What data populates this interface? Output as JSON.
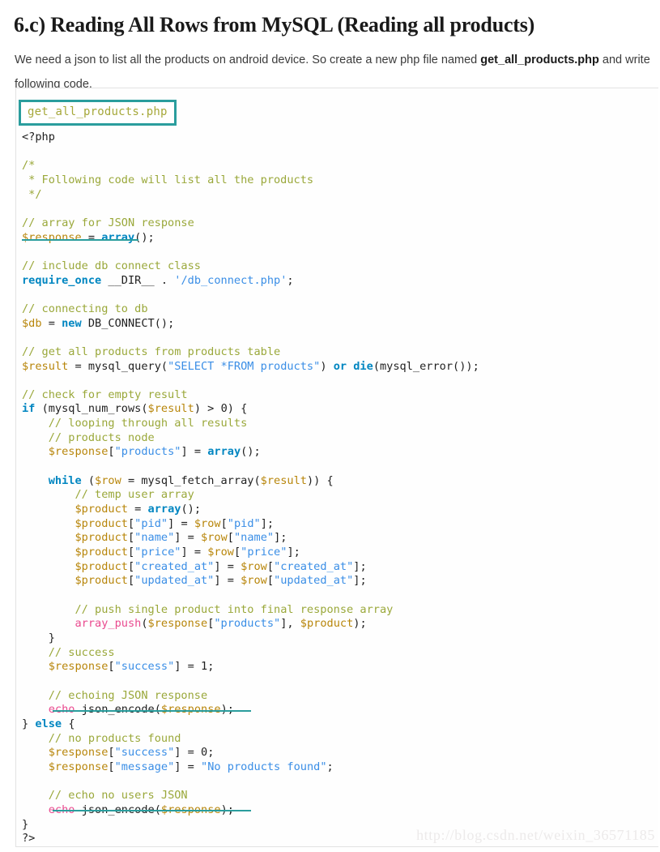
{
  "heading": "6.c) Reading All Rows from MySQL (Reading all products)",
  "intro": {
    "before": "We need a json to list all the products on android device. So create a new php file named ",
    "file_name": "get_all_products.php",
    "after": " and write following code."
  },
  "code_block": {
    "filename_chip": "get_all_products.php",
    "language": "php",
    "source": "<?php\n\n/*\n * Following code will list all the products\n */\n\n// array for JSON response\n$response = array();\n\n// include db connect class\nrequire_once __DIR__ . '/db_connect.php';\n\n// connecting to db\n$db = new DB_CONNECT();\n\n// get all products from products table\n$result = mysql_query(\"SELECT *FROM products\") or die(mysql_error());\n\n// check for empty result\nif (mysql_num_rows($result) > 0) {\n    // looping through all results\n    // products node\n    $response[\"products\"] = array();\n\n    while ($row = mysql_fetch_array($result)) {\n        // temp user array\n        $product = array();\n        $product[\"pid\"] = $row[\"pid\"];\n        $product[\"name\"] = $row[\"name\"];\n        $product[\"price\"] = $row[\"price\"];\n        $product[\"created_at\"] = $row[\"created_at\"];\n        $product[\"updated_at\"] = $row[\"updated_at\"];\n\n        // push single product into final response array\n        array_push($response[\"products\"], $product);\n    }\n    // success\n    $response[\"success\"] = 1;\n\n    // echoing JSON response\n    echo json_encode($response);\n} else {\n    // no products found\n    $response[\"success\"] = 0;\n    $response[\"message\"] = \"No products found\";\n\n    // echo no users JSON\n    echo json_encode($response);\n}\n?>",
    "lines": [
      "<?php",
      "",
      "/*",
      " * Following code will list all the products",
      " */",
      "",
      "// array for JSON response",
      "$response = array();",
      "",
      "// include db connect class",
      "require_once __DIR__ . '/db_connect.php';",
      "",
      "// connecting to db",
      "$db = new DB_CONNECT();",
      "",
      "// get all products from products table",
      "$result = mysql_query(\"SELECT *FROM products\") or die(mysql_error());",
      "",
      "// check for empty result",
      "if (mysql_num_rows($result) > 0) {",
      "    // looping through all results",
      "    // products node",
      "    $response[\"products\"] = array();",
      "",
      "    while ($row = mysql_fetch_array($result)) {",
      "        // temp user array",
      "        $product = array();",
      "        $product[\"pid\"] = $row[\"pid\"];",
      "        $product[\"name\"] = $row[\"name\"];",
      "        $product[\"price\"] = $row[\"price\"];",
      "        $product[\"created_at\"] = $row[\"created_at\"];",
      "        $product[\"updated_at\"] = $row[\"updated_at\"];",
      "",
      "        // push single product into final response array",
      "        array_push($response[\"products\"], $product);",
      "    }",
      "    // success",
      "    $response[\"success\"] = 1;",
      "",
      "    // echoing JSON response",
      "    echo json_encode($response);",
      "} else {",
      "    // no products found",
      "    $response[\"success\"] = 0;",
      "    $response[\"message\"] = \"No products found\";",
      "",
      "    // echo no users JSON",
      "    echo json_encode($response);",
      "}",
      "?>"
    ],
    "annotations": [
      {
        "target": "$response = array()",
        "style": "underline",
        "color": "#2a9d9d"
      },
      {
        "target": "echo json_encode($response)",
        "style": "underline",
        "color": "#2a9d9d"
      },
      {
        "target": "echo json_encode($response)",
        "style": "underline",
        "color": "#2a9d9d"
      }
    ]
  },
  "watermark": "http://blog.csdn.net/weixin_36571185",
  "colors": {
    "accent_teal": "#2a9d9d",
    "comment": "#9aa83a",
    "keyword": "#0086c1",
    "variable": "#b8860b",
    "string": "#3a8ee6",
    "function_special": "#ea4a8f",
    "text": "#1f1f1f",
    "watermark": "#eceaea"
  }
}
